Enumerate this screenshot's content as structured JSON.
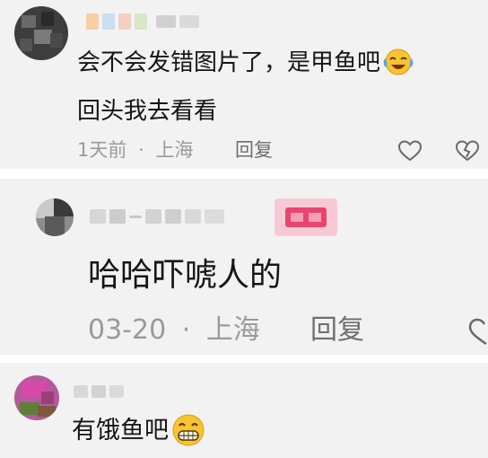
{
  "comments": [
    {
      "content_lines": [
        "会不会发错图片了，是甲鱼吧",
        "回头我去看看"
      ],
      "content_emoji": "laugh-cry-emoji",
      "time": "1天前",
      "location": "上海",
      "separator": "·",
      "reply_label": "回复"
    },
    {
      "content_lines": [
        "哈哈吓唬人的"
      ],
      "time": "03-20",
      "location": "上海",
      "separator": "·",
      "reply_label": "回复"
    },
    {
      "content_lines": [
        "有饿鱼吧"
      ],
      "content_emoji": "grin-emoji"
    }
  ],
  "colors": {
    "card_bg": "#f2f2f2",
    "meta_text": "#9a9a9a",
    "content_text": "#151515",
    "badge_pink": "#e8456d"
  }
}
